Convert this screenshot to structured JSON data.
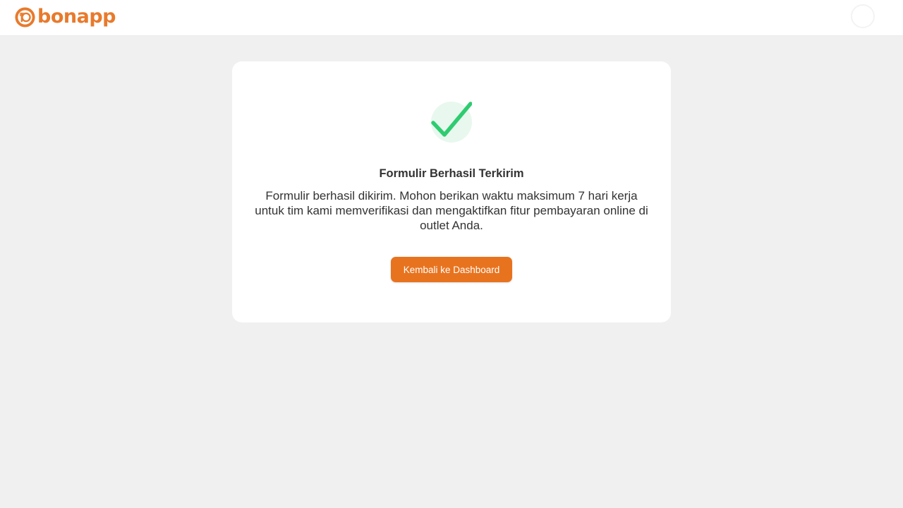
{
  "header": {
    "logo_text": "bonapp",
    "user_name": "",
    "user_role": ""
  },
  "card": {
    "title": "Formulir Berhasil Terkirim",
    "message": "Formulir berhasil dikirim. Mohon berikan waktu maksimum 7 hari kerja untuk tim kami memverifikasi dan mengaktifkan fitur pembayaran online di outlet Anda.",
    "button_label": "Kembali ke Dashboard",
    "icon": "check-circle-icon"
  },
  "colors": {
    "brand": "#e87a2c",
    "button": "#e8731e",
    "success": "#2ecc71",
    "success_bg": "#e8f8ee",
    "page_bg": "#f0f0f0"
  }
}
